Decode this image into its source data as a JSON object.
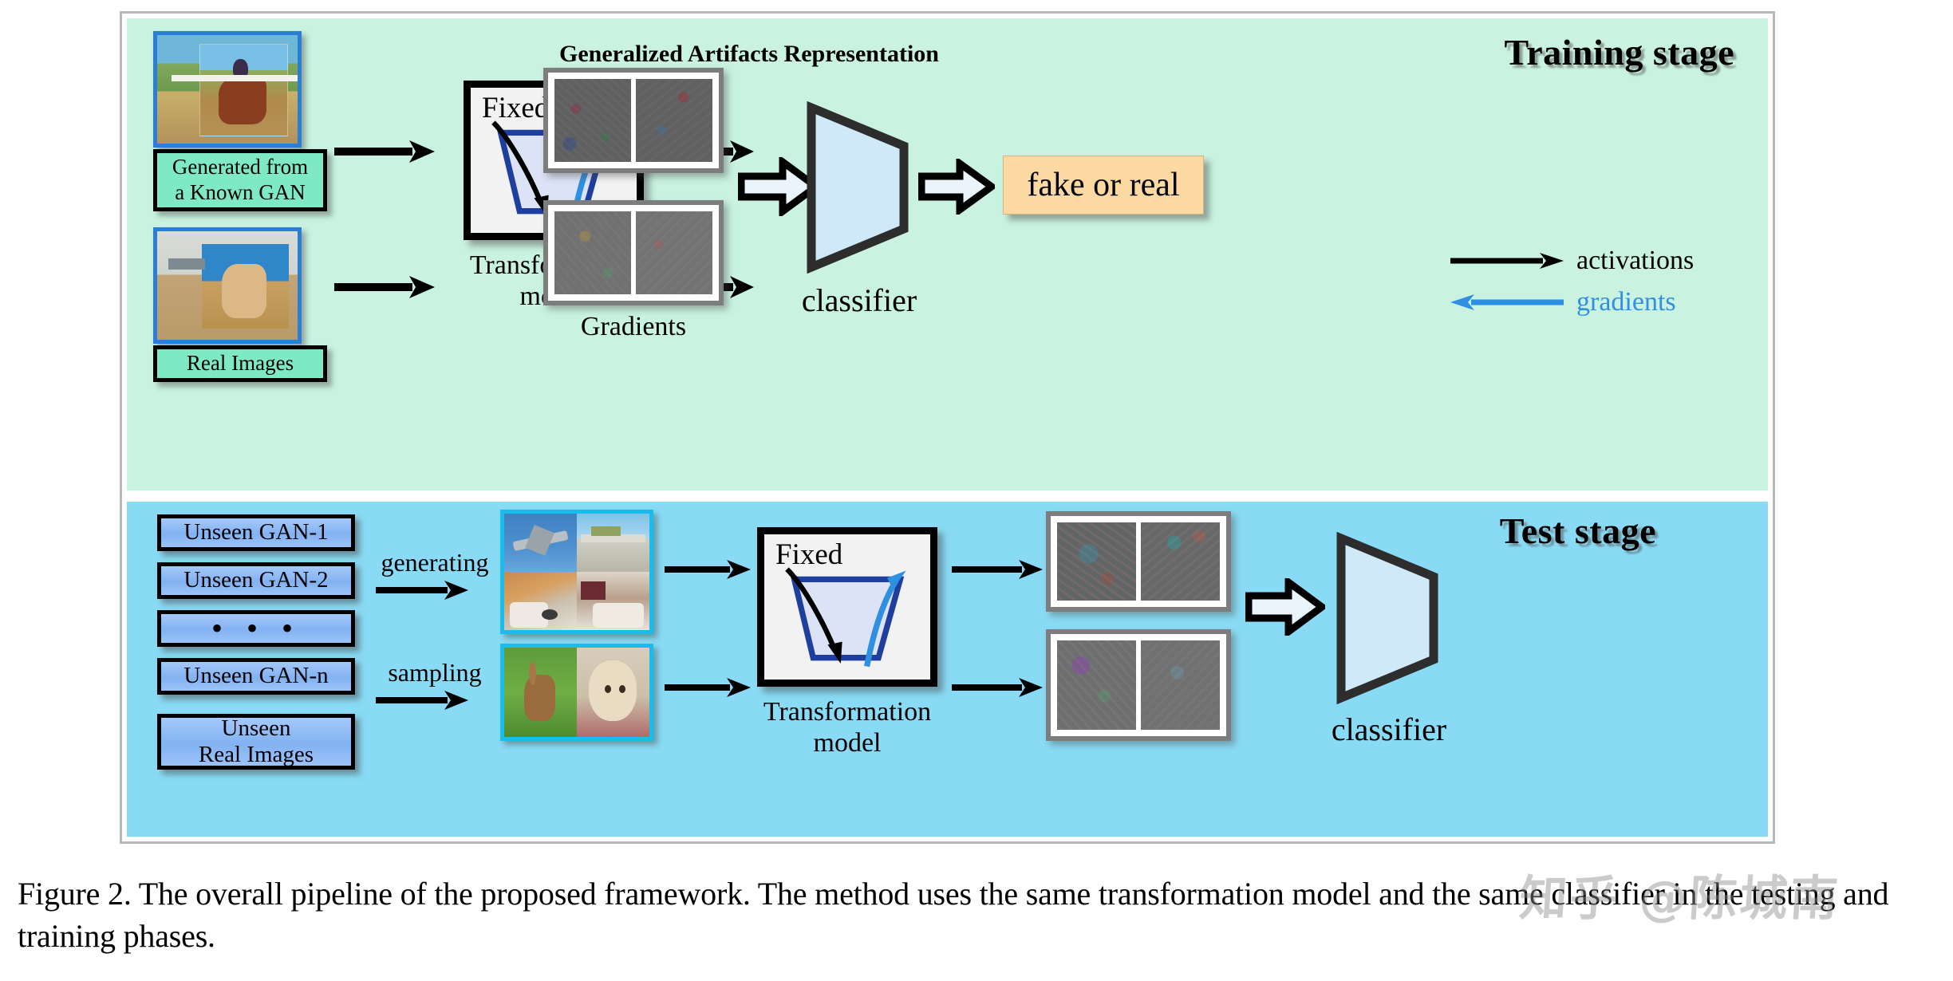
{
  "figure": {
    "caption": "Figure 2. The overall pipeline of the proposed framework. The method uses the same transformation model and the same classifier in the testing and training phases.",
    "watermark": "知乎 @陈城南"
  },
  "training_stage": {
    "title": "Training stage",
    "inputs": [
      {
        "label": "Generated from\na Known GAN",
        "label_line1": "Generated from",
        "label_line2": "a Known GAN"
      },
      {
        "label": "Real Images"
      }
    ],
    "transformation_model": {
      "fixed_label": "Fixed",
      "caption_line1": "Transformation",
      "caption_line2": "model"
    },
    "representation_title": "Generalized Artifacts Representation",
    "gradients_label": "Gradients",
    "classifier_label": "classifier",
    "output_label": "fake or real",
    "legend": [
      {
        "name": "activations",
        "color": "#000000",
        "direction": "right"
      },
      {
        "name": "gradients",
        "color": "#2f8fe0",
        "direction": "left"
      }
    ]
  },
  "test_stage": {
    "title": "Test stage",
    "sources": [
      {
        "label": "Unseen GAN-1"
      },
      {
        "label": "Unseen GAN-2"
      },
      {
        "label": "• • •"
      },
      {
        "label": "Unseen GAN-n"
      }
    ],
    "real_source": {
      "line1": "Unseen",
      "line2": "Real Images"
    },
    "edge_labels": [
      {
        "label": "generating"
      },
      {
        "label": "sampling"
      }
    ],
    "transformation_model": {
      "fixed_label": "Fixed",
      "caption_line1": "Transformation",
      "caption_line2": "model"
    },
    "classifier_label": "classifier"
  },
  "colors": {
    "training_bg": "#c9f2e0",
    "test_bg": "#89dbf5",
    "label_green": "#7fe8c4",
    "gan_blue": "#8cb9f5",
    "output_orange": "#fcd9a2",
    "classifier_fill": "#cfe9f8",
    "gradient_blue": "#2f8fe0",
    "photo_border": "#2a7fd4",
    "photo_border_cyan": "#18bdec"
  }
}
